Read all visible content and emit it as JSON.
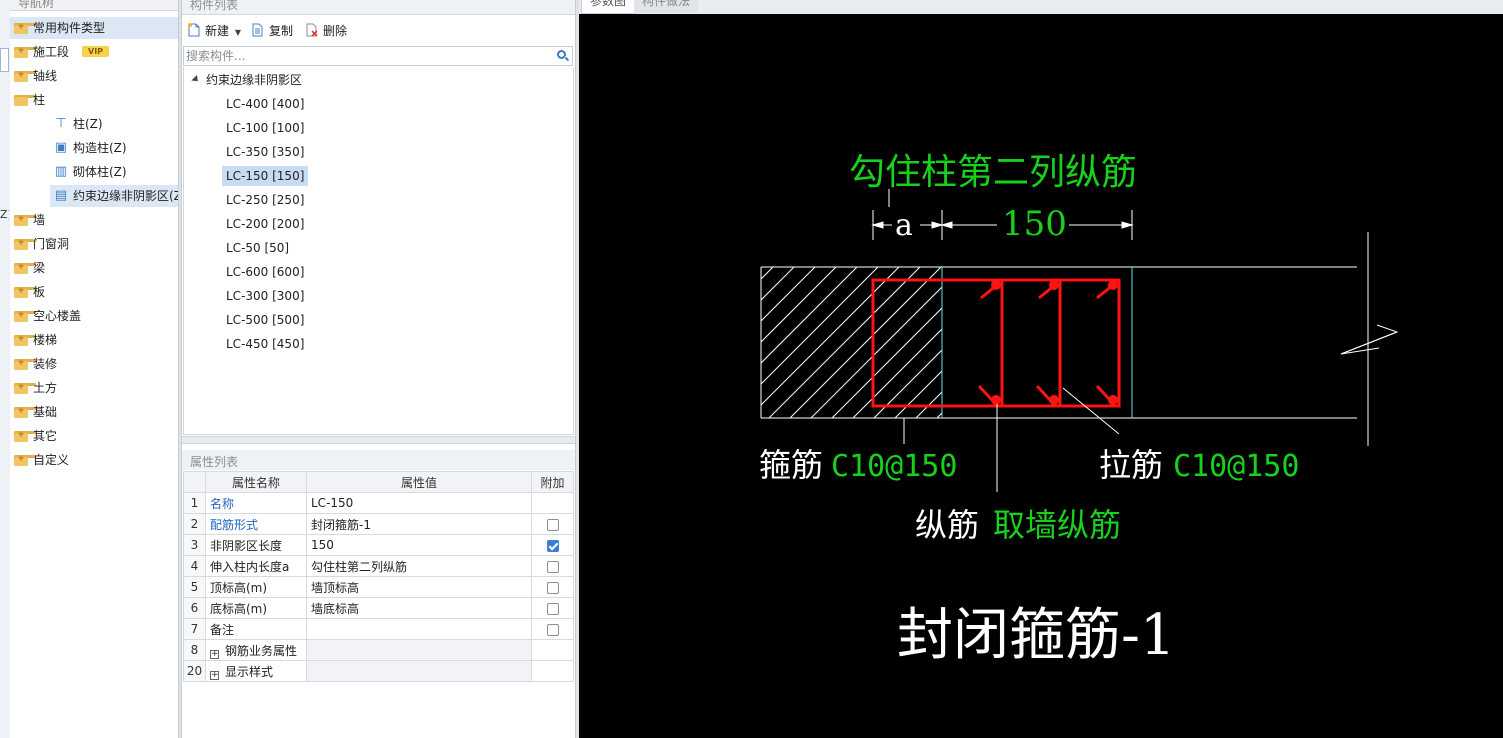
{
  "nav": {
    "title": "导航树",
    "items": [
      {
        "label": "常用构件类型",
        "type": "folder",
        "selected": true
      },
      {
        "label": "施工段",
        "type": "folder",
        "badge": "VIP"
      },
      {
        "label": "轴线",
        "type": "folder"
      },
      {
        "label": "柱",
        "type": "folder-open"
      },
      {
        "label": "柱(Z)",
        "type": "leaf",
        "icon": "column-icon"
      },
      {
        "label": "构造柱(Z)",
        "type": "leaf",
        "icon": "constructional-column-icon"
      },
      {
        "label": "砌体柱(Z)",
        "type": "leaf",
        "icon": "masonry-column-icon"
      },
      {
        "label": "约束边缘非阴影区(Z",
        "type": "leaf",
        "icon": "edge-zone-icon",
        "selected": true
      },
      {
        "label": "墙",
        "type": "folder"
      },
      {
        "label": "门窗洞",
        "type": "folder"
      },
      {
        "label": "梁",
        "type": "folder"
      },
      {
        "label": "板",
        "type": "folder"
      },
      {
        "label": "空心楼盖",
        "type": "folder"
      },
      {
        "label": "楼梯",
        "type": "folder"
      },
      {
        "label": "装修",
        "type": "folder"
      },
      {
        "label": "土方",
        "type": "folder"
      },
      {
        "label": "基础",
        "type": "folder"
      },
      {
        "label": "其它",
        "type": "folder"
      },
      {
        "label": "自定义",
        "type": "folder"
      }
    ],
    "strip_label": "Z)"
  },
  "component_list": {
    "title": "构件列表",
    "toolbar": {
      "new_label": "新建",
      "copy_label": "复制",
      "delete_label": "删除"
    },
    "search_placeholder": "搜索构件...",
    "group_label": "约束边缘非阴影区",
    "items": [
      "LC-400 [400]",
      "LC-100 [100]",
      "LC-350 [350]",
      "LC-150 [150]",
      "LC-250 [250]",
      "LC-200 [200]",
      "LC-50 [50]",
      "LC-600 [600]",
      "LC-300 [300]",
      "LC-500 [500]",
      "LC-450 [450]"
    ],
    "selected_index": 3
  },
  "properties": {
    "title": "属性列表",
    "columns": [
      "属性名称",
      "属性值",
      "附加"
    ],
    "rows": [
      {
        "no": "1",
        "name": "名称",
        "value": "LC-150",
        "blue": true,
        "checkbox": null
      },
      {
        "no": "2",
        "name": "配筋形式",
        "value": "封闭箍筋-1",
        "blue": true,
        "checkbox": false
      },
      {
        "no": "3",
        "name": "非阴影区长度",
        "value": "150",
        "blue": false,
        "checkbox": true
      },
      {
        "no": "4",
        "name": "伸入柱内长度a",
        "value": "勾住柱第二列纵筋",
        "blue": false,
        "checkbox": false
      },
      {
        "no": "5",
        "name": "顶标高(m)",
        "value": "墙顶标高",
        "blue": false,
        "checkbox": false
      },
      {
        "no": "6",
        "name": "底标高(m)",
        "value": "墙底标高",
        "blue": false,
        "checkbox": false
      },
      {
        "no": "7",
        "name": "备注",
        "value": "",
        "blue": false,
        "checkbox": false
      },
      {
        "no": "8",
        "name": "钢筋业务属性",
        "value": "",
        "group": true
      },
      {
        "no": "20",
        "name": "显示样式",
        "value": "",
        "group": true
      }
    ]
  },
  "drawing": {
    "tabs": [
      "参数图",
      "构件做法"
    ],
    "labels": {
      "top_note": "勾住柱第二列纵筋",
      "dim_a": "a",
      "dim_150": "150",
      "stirrup_cn": "箍筋",
      "stirrup_spec": "C10@150",
      "tie_cn": "拉筋",
      "tie_spec": "C10@150",
      "long_cn": "纵筋",
      "long_spec": "取墙纵筋",
      "form_title": "封闭箍筋-1"
    },
    "colors": {
      "background": "#000000",
      "green": "#17d11c",
      "red": "#ff1414",
      "white": "#ffffff",
      "cyan": "#5fe0e8"
    }
  }
}
